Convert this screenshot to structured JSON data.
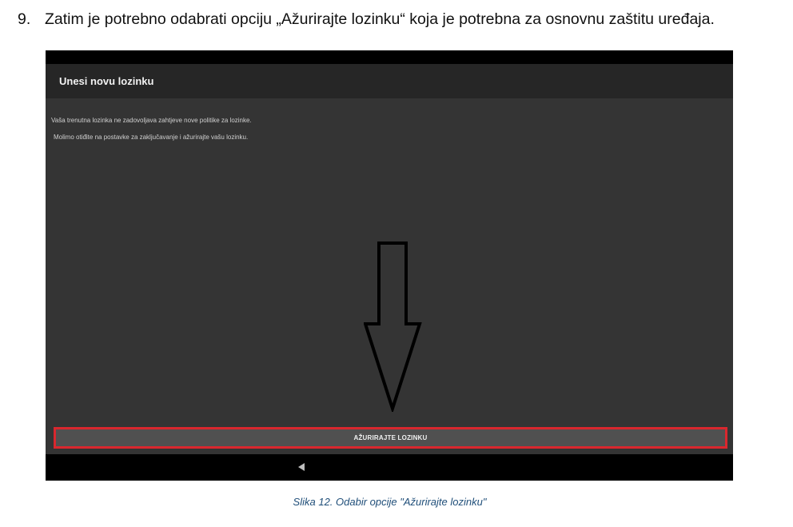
{
  "instruction": {
    "number": "9.",
    "text": "Zatim je potrebno odabrati opciju „Ažurirajte lozinku“ koja je potrebna za osnovnu zaštitu uređaja."
  },
  "screen": {
    "title": "Unesi novu lozinku",
    "message_line1": "Vaša trenutna lozinka ne zadovoljava zahtjeve nove politike za lozinke.",
    "message_line2": "Molimo otiđite na postavke za zaključavanje i ažurirajte vašu lozinku.",
    "button_label": "AŽURIRAJTE LOZINKU",
    "nav_back_icon": "triangle-back-icon"
  },
  "annotation": {
    "arrow": "down-arrow",
    "highlight_color": "#d9272e"
  },
  "caption": "Slika 12. Odabir opcije \"Ažurirajte lozinku\""
}
